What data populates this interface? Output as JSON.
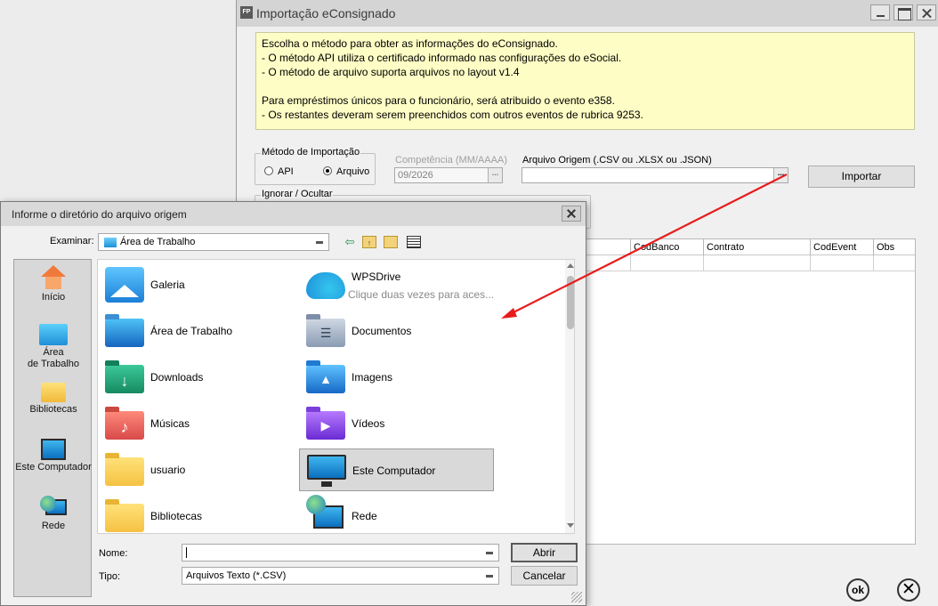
{
  "main_window": {
    "title": "Importação eConsignado",
    "app_icon_text": "FP",
    "info_lines": [
      "Escolha o método para obter as informações do eConsignado.",
      "- O método API utiliza o certificado informado nas configurações do eSocial.",
      "- O método de arquivo suporta arquivos no layout v1.4",
      "",
      "Para empréstimos únicos para o funcionário, será atribuido o evento e358.",
      "- Os restantes deveram serem preenchidos com outros eventos de rubrica 9253."
    ],
    "metodo_group_label": "Método de Importação",
    "radio_api_label": "API",
    "radio_arquivo_label": "Arquivo",
    "competencia_label": "Competência (MM/AAAA)",
    "competencia_value": "09/2026",
    "arquivo_label": "Arquivo Origem (.CSV ou .XLSX ou .JSON)",
    "arquivo_value": "",
    "ellipsis": "...",
    "importar_label": "Importar",
    "ignorar_group_label": "Ignorar / Ocultar",
    "grid_columns": [
      "CodBanco",
      "Contrato",
      "CodEvent",
      "Obs"
    ],
    "ok_label": "ok",
    "close_glyph": "✕"
  },
  "dialog": {
    "title": "Informe o diretório do arquivo origem",
    "look_in_label": "Examinar:",
    "look_in_value": "Área de Trabalho",
    "toolbar_icons": [
      "back-icon",
      "up-folder-icon",
      "new-folder-icon",
      "view-menu-icon"
    ],
    "places": [
      {
        "label": "Início",
        "icon": "home-icon"
      },
      {
        "label": "Área\nde Trabalho",
        "icon": "desktop-icon"
      },
      {
        "label": "Bibliotecas",
        "icon": "libraries-icon"
      },
      {
        "label": "Este Computador",
        "icon": "computer-icon"
      },
      {
        "label": "Rede",
        "icon": "network-icon"
      }
    ],
    "files": [
      {
        "name": "Galeria",
        "icon": "gallery-icon"
      },
      {
        "name": "WPSDrive",
        "subtitle": "Clique duas vezes para aces...",
        "icon": "cloud-icon"
      },
      {
        "name": "Área de Trabalho",
        "icon": "desktop-folder-icon"
      },
      {
        "name": "Documentos",
        "icon": "documents-folder-icon"
      },
      {
        "name": "Downloads",
        "icon": "downloads-folder-icon"
      },
      {
        "name": "Imagens",
        "icon": "pictures-folder-icon"
      },
      {
        "name": "Músicas",
        "icon": "music-folder-icon"
      },
      {
        "name": "Vídeos",
        "icon": "videos-folder-icon"
      },
      {
        "name": "usuario",
        "icon": "user-folder-icon"
      },
      {
        "name": "Este Computador",
        "icon": "computer-icon",
        "selected": true
      },
      {
        "name": "Bibliotecas",
        "icon": "libraries-folder-icon"
      },
      {
        "name": "Rede",
        "icon": "network-icon"
      }
    ],
    "name_label": "Nome:",
    "name_value": "",
    "type_label": "Tipo:",
    "type_value": "Arquivos Texto (*.CSV)",
    "open_label": "Abrir",
    "cancel_label": "Cancelar"
  },
  "colors": {
    "info_background": "#fdfdc5",
    "annotation_arrow": "#e81c1c"
  }
}
